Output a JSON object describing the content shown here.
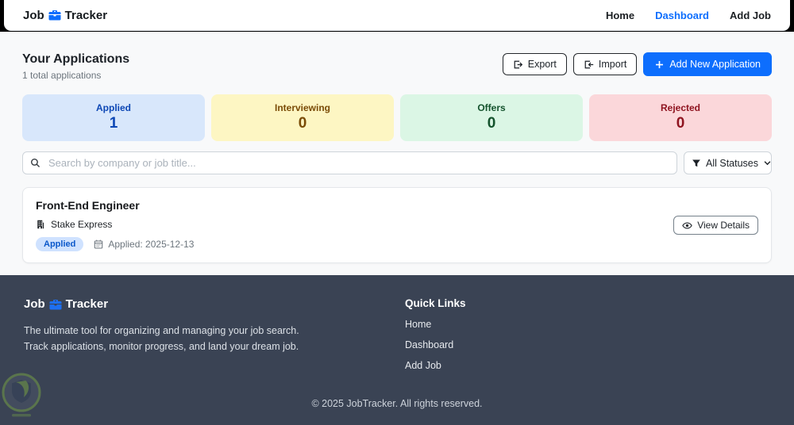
{
  "brand": {
    "word1": "Job",
    "word2": "Tracker",
    "accent_color": "#0d6efd"
  },
  "navbar": {
    "links": [
      {
        "label": "Home",
        "active": false
      },
      {
        "label": "Dashboard",
        "active": true
      },
      {
        "label": "Add Job",
        "active": false
      }
    ]
  },
  "header": {
    "title": "Your Applications",
    "subtitle": "1 total applications",
    "export_label": "Export",
    "import_label": "Import",
    "add_label": "Add New Application"
  },
  "stats": [
    {
      "label": "Applied",
      "count": 1,
      "bg": "#d8e7fb",
      "color": "#0d47b5"
    },
    {
      "label": "Interviewing",
      "count": 0,
      "bg": "#fdf6c3",
      "color": "#7a4b06"
    },
    {
      "label": "Offers",
      "count": 0,
      "bg": "#dbf6e5",
      "color": "#14532d"
    },
    {
      "label": "Rejected",
      "count": 0,
      "bg": "#fbd7da",
      "color": "#8f1420"
    }
  ],
  "filters": {
    "search_placeholder": "Search by company or job title...",
    "search_value": "",
    "status_selected": "All Statuses"
  },
  "applications": [
    {
      "title": "Front-End Engineer",
      "company": "Stake Express",
      "status_badge": "Applied",
      "date_label": "Applied: 2025-12-13",
      "action_label": "View Details"
    }
  ],
  "footer": {
    "brand_word1": "Job",
    "brand_word2": "Tracker",
    "tagline_line1": "The ultimate tool for organizing and managing your job search.",
    "tagline_line2": "Track applications, monitor progress, and land your dream job.",
    "quick_links_title": "Quick Links",
    "quick_links": [
      {
        "label": "Home"
      },
      {
        "label": "Dashboard"
      },
      {
        "label": "Add Job"
      }
    ],
    "copyright": "© 2025 JobTracker. All rights reserved."
  },
  "icons": {
    "brand": "briefcase-icon",
    "export": "export-arrow-icon",
    "import": "import-arrow-icon",
    "add": "plus-icon",
    "search": "search-icon",
    "status_filter": "funnel-icon",
    "status_filter_caret": "chevron-down-icon",
    "company": "building-icon",
    "date": "calendar-icon",
    "view": "eye-icon",
    "watermark": "shield-leaf-logo"
  }
}
